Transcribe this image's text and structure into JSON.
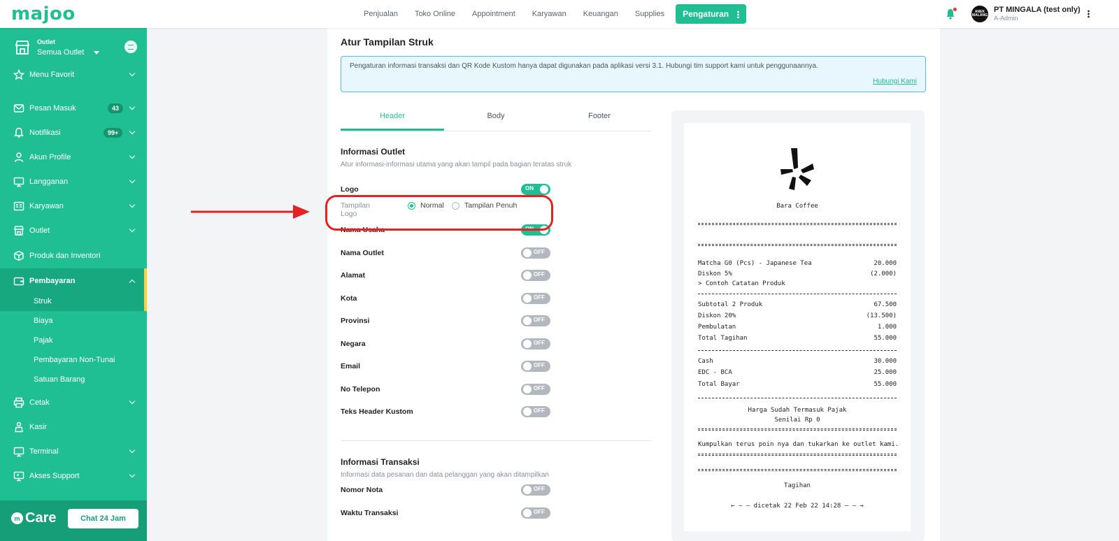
{
  "app": {
    "logo_text": "majoo"
  },
  "topnav": {
    "items": [
      "Penjualan",
      "Toko Online",
      "Appointment",
      "Karyawan",
      "Keuangan",
      "Supplies"
    ],
    "active": "Pengaturan"
  },
  "user": {
    "avatar_text": "ANEK MALANG",
    "company": "PT MINGALA (test only)",
    "role": "A-Admin"
  },
  "sidebar": {
    "outlet_label": "Outlet",
    "outlet_value": "Semua Outlet",
    "items": [
      {
        "label": "Menu Favorit",
        "icon": "star-icon"
      },
      {
        "label": "Pesan Masuk",
        "icon": "mail-icon",
        "badge": "43"
      },
      {
        "label": "Notifikasi",
        "icon": "bell-icon",
        "badge": "99+"
      },
      {
        "label": "Akun Profile",
        "icon": "user-icon"
      },
      {
        "label": "Langganan",
        "icon": "monitor-icon"
      },
      {
        "label": "Karyawan",
        "icon": "id-card-icon"
      },
      {
        "label": "Outlet",
        "icon": "store-icon"
      },
      {
        "label": "Produk dan Inventori",
        "icon": "box-icon"
      },
      {
        "label": "Pembayaran",
        "icon": "wallet-icon"
      },
      {
        "label": "Cetak",
        "icon": "printer-icon"
      },
      {
        "label": "Kasir",
        "icon": "cashier-icon"
      },
      {
        "label": "Terminal",
        "icon": "terminal-icon"
      },
      {
        "label": "Akses Support",
        "icon": "support-icon"
      }
    ],
    "sub_items": [
      "Struk",
      "Biaya",
      "Pajak",
      "Pembayaran Non-Tunai",
      "Satuan Barang"
    ],
    "care_label": "Care",
    "chat_button": "Chat 24 Jam"
  },
  "page": {
    "title": "Atur Tampilan Struk",
    "info_text": "Pengaturan informasi transaksi dan QR Kode Kustom hanya dapat digunakan pada aplikasi versi 3.1. Hubungi tim support kami untuk penggunaannya.",
    "info_link": "Hubungi Kami",
    "tabs": [
      "Header",
      "Body",
      "Footer"
    ],
    "section1": {
      "title": "Informasi Outlet",
      "desc": "Atur informasi-informasi utama yang akan tampil pada bagian teratas struk"
    },
    "logo_row": {
      "label": "Logo",
      "state": "ON"
    },
    "logo_display": {
      "label": "Tampilan Logo",
      "option_normal": "Normal",
      "option_full": "Tampilan Penuh",
      "selected": "Normal"
    },
    "toggles": [
      {
        "label": "Nama Usaha",
        "state": "ON"
      },
      {
        "label": "Nama Outlet",
        "state": "OFF"
      },
      {
        "label": "Alamat",
        "state": "OFF"
      },
      {
        "label": "Kota",
        "state": "OFF"
      },
      {
        "label": "Provinsi",
        "state": "OFF"
      },
      {
        "label": "Negara",
        "state": "OFF"
      },
      {
        "label": "Email",
        "state": "OFF"
      },
      {
        "label": "No Telepon",
        "state": "OFF"
      },
      {
        "label": "Teks Header Kustom",
        "state": "OFF"
      }
    ],
    "section2": {
      "title": "Informasi Transaksi",
      "desc": "Informasi data pesanan dan data pelanggan yang akan ditampilkan"
    },
    "toggles2": [
      {
        "label": "Nomor Nota",
        "state": "OFF"
      },
      {
        "label": "Waktu Transaksi",
        "state": "OFF"
      }
    ]
  },
  "receipt": {
    "business_name": "Bara Coffee",
    "item1": {
      "name": "Matcha G0 (Pcs) - Japanese Tea",
      "amount": "20.000"
    },
    "item1_discount": {
      "name": "Diskon 5%",
      "amount": "(2.000)"
    },
    "item1_note": "> Contoh Catatan Produk",
    "subtotal": {
      "name": "Subtotal 2 Produk",
      "amount": "67.500"
    },
    "discount": {
      "name": "Diskon 20%",
      "amount": "(13.500)"
    },
    "rounding": {
      "name": "Pembulatan",
      "amount": "1.000"
    },
    "total": {
      "name": "Total Tagihan",
      "amount": "55.000"
    },
    "cash": {
      "name": "Cash",
      "amount": "30.000"
    },
    "edc": {
      "name": "EDC - BCA",
      "amount": "25.000"
    },
    "total_paid": {
      "name": "Total Bayar",
      "amount": "55.000"
    },
    "tax_note1": "Harga Sudah Termasuk Pajak",
    "tax_note2": "Senilai Rp 0",
    "loyalty": "Kumpulkan terus poin nya dan tukarkan ke outlet kami.",
    "doc_type": "Tagihan",
    "printed": "←  – – dicetak 22 Feb 22 14:28 – –  →"
  },
  "colors": {
    "brand": "#1fbf93",
    "highlight": "#e52222"
  }
}
